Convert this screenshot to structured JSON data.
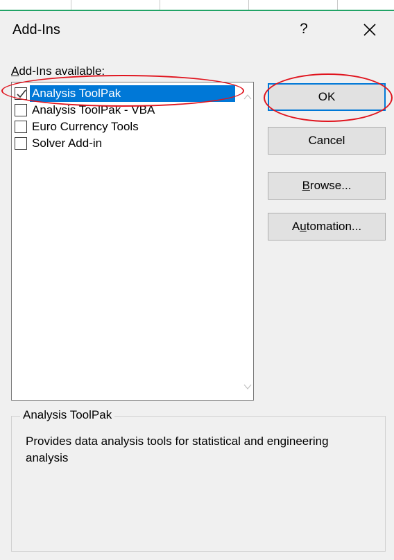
{
  "dialog": {
    "title": "Add-Ins",
    "help_label": "?"
  },
  "list": {
    "label_prefix": "",
    "label_underlined": "A",
    "label_rest": "dd-Ins available:",
    "items": [
      {
        "label": "Analysis ToolPak",
        "checked": true,
        "selected": true
      },
      {
        "label": "Analysis ToolPak - VBA",
        "checked": false,
        "selected": false
      },
      {
        "label": "Euro Currency Tools",
        "checked": false,
        "selected": false
      },
      {
        "label": "Solver Add-in",
        "checked": false,
        "selected": false
      }
    ]
  },
  "buttons": {
    "ok": "OK",
    "cancel": "Cancel",
    "browse_underlined": "B",
    "browse_rest": "rowse...",
    "automation_prefix": "A",
    "automation_underlined": "u",
    "automation_rest": "tomation..."
  },
  "description": {
    "heading": "Analysis ToolPak",
    "text": "Provides data analysis tools for statistical and engineering analysis"
  },
  "colors": {
    "selection": "#0078d7",
    "annotation": "#e0141e"
  }
}
